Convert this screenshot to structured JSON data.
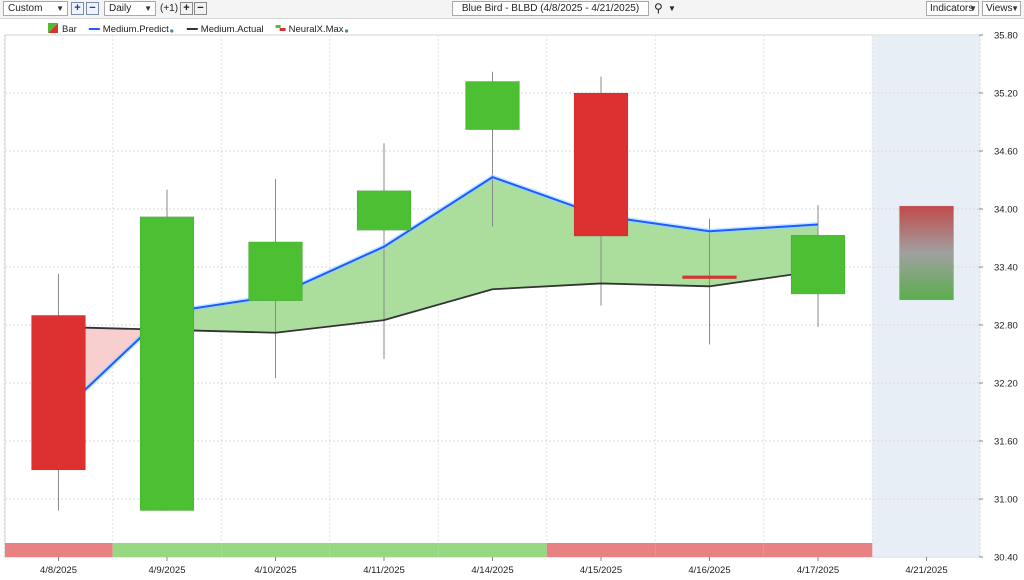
{
  "toolbar": {
    "range_select": "Custom",
    "plus_button": "+",
    "minus_button": "−",
    "period_select": "Daily",
    "offset_label": "(+1)",
    "plus2_button": "+",
    "minus2_button": "−",
    "chart_title": "Blue Bird - BLBD (4/8/2025 - 4/21/2025)",
    "indicators_label": "Indicators",
    "views_label": "Views"
  },
  "legend": [
    {
      "label": "Bar",
      "icon": "bar-icon"
    },
    {
      "label": "Medium.Predict",
      "color": "#1f5bff",
      "dot": true
    },
    {
      "label": "Medium.Actual",
      "color": "#333333",
      "dot": false
    },
    {
      "label": "NeuralX.Max",
      "icon": "neuralx-icon",
      "dot": true
    }
  ],
  "chart_data": {
    "type": "candlestick",
    "categories": [
      "4/8/2025",
      "4/9/2025",
      "4/10/2025",
      "4/11/2025",
      "4/14/2025",
      "4/15/2025",
      "4/16/2025",
      "4/17/2025",
      "4/21/2025"
    ],
    "ylim": [
      30.4,
      35.8
    ],
    "yticks": [
      "35.80",
      "35.20",
      "34.60",
      "34.00",
      "33.40",
      "32.80",
      "32.20",
      "31.60",
      "31.00",
      "30.40"
    ],
    "candles": [
      {
        "open": 32.9,
        "close": 31.3,
        "high": 33.33,
        "low": 30.88,
        "direction": "down"
      },
      {
        "open": 30.88,
        "close": 33.92,
        "high": 34.2,
        "low": 30.88,
        "direction": "up"
      },
      {
        "open": 33.05,
        "close": 33.66,
        "high": 34.31,
        "low": 32.25,
        "direction": "up"
      },
      {
        "open": 33.78,
        "close": 34.19,
        "high": 34.68,
        "low": 32.45,
        "direction": "up"
      },
      {
        "open": 34.82,
        "close": 35.32,
        "high": 35.42,
        "low": 33.82,
        "direction": "up"
      },
      {
        "open": 35.2,
        "close": 33.72,
        "high": 35.37,
        "low": 33.0,
        "direction": "down"
      },
      {
        "open": 33.31,
        "close": 33.28,
        "high": 33.9,
        "low": 32.6,
        "direction": "down"
      },
      {
        "open": 33.12,
        "close": 33.73,
        "high": 34.04,
        "low": 32.78,
        "direction": "up"
      },
      {
        "open": 34.03,
        "close": 33.06,
        "high": 34.03,
        "low": 33.06,
        "direction": "forecast"
      }
    ],
    "series": [
      {
        "name": "Medium.Predict",
        "color": "#1f5bff",
        "values": [
          31.87,
          32.93,
          33.1,
          33.61,
          34.33,
          33.93,
          33.77,
          33.84,
          null
        ]
      },
      {
        "name": "Medium.Actual",
        "color": "#333333",
        "values": [
          32.78,
          32.75,
          32.72,
          32.85,
          33.17,
          33.23,
          33.2,
          33.36,
          null
        ]
      }
    ],
    "signal_strip": [
      "down",
      "up",
      "up",
      "up",
      "up",
      "down",
      "down",
      "down",
      null
    ],
    "colors": {
      "up": "#4cbf33",
      "down": "#dd3030",
      "fill_up": "#a6dc98",
      "fill_down": "#f7cccc",
      "strip_up": "#96d782",
      "strip_down": "#e88282",
      "forecast_bg": "#e8eef6"
    }
  }
}
